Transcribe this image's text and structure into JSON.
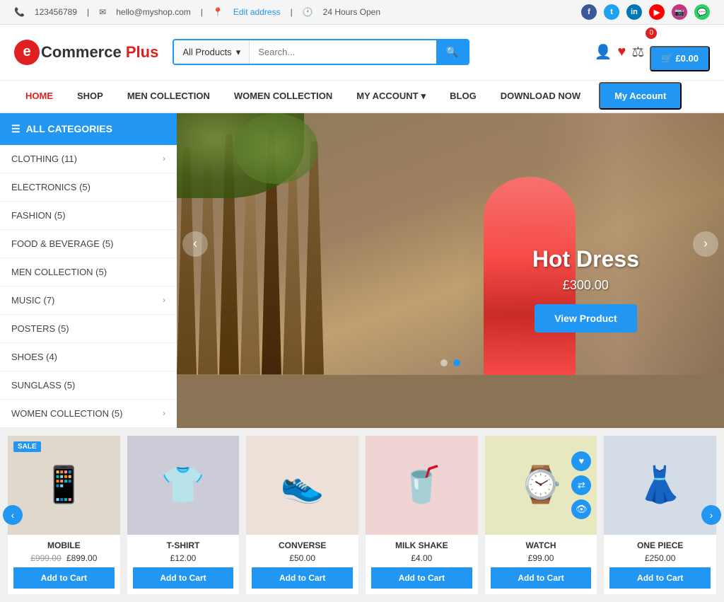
{
  "topbar": {
    "phone": "123456789",
    "email": "hello@myshop.com",
    "address": "Edit address",
    "hours": "24 Hours Open",
    "socials": [
      "fb",
      "tw",
      "li",
      "yt",
      "ig",
      "wa"
    ]
  },
  "header": {
    "logo_letter": "e",
    "logo_name": "Commerce ",
    "logo_plus": "Plus",
    "search_placeholder": "Search...",
    "search_dropdown": "All Products",
    "cart_amount": "£0.00",
    "cart_count": "0"
  },
  "nav": {
    "items": [
      {
        "label": "HOME",
        "active": true
      },
      {
        "label": "SHOP",
        "active": false
      },
      {
        "label": "MEN COLLECTION",
        "active": false
      },
      {
        "label": "WOMEN COLLECTION",
        "active": false
      },
      {
        "label": "MY ACCOUNT",
        "active": false,
        "has_dropdown": true
      },
      {
        "label": "BLOG",
        "active": false
      },
      {
        "label": "DOWNLOAD NOW",
        "active": false
      }
    ],
    "cta_label": "My Account"
  },
  "sidebar": {
    "header": "ALL CATEGORIES",
    "items": [
      {
        "label": "CLOTHING (11)",
        "has_arrow": true
      },
      {
        "label": "ELECTRONICS (5)",
        "has_arrow": false
      },
      {
        "label": "FASHION (5)",
        "has_arrow": false
      },
      {
        "label": "FOOD & BEVERAGE (5)",
        "has_arrow": false
      },
      {
        "label": "MEN COLLECTION (5)",
        "has_arrow": false
      },
      {
        "label": "MUSIC (7)",
        "has_arrow": true
      },
      {
        "label": "POSTERS (5)",
        "has_arrow": false
      },
      {
        "label": "SHOES (4)",
        "has_arrow": false
      },
      {
        "label": "SUNGLASS (5)",
        "has_arrow": false
      },
      {
        "label": "WOMEN COLLECTION (5)",
        "has_arrow": true
      }
    ]
  },
  "hero": {
    "title": "Hot Dress",
    "price": "£300.00",
    "btn_label": "View Product",
    "dots": [
      false,
      true
    ]
  },
  "products": {
    "prev_label": "‹",
    "next_label": "›",
    "items": [
      {
        "name": "MOBILE",
        "price_old": "£999.00",
        "price_new": "£899.00",
        "sale": true,
        "emoji": "📱",
        "bg": "#e8e0d8",
        "btn": "Add to Cart"
      },
      {
        "name": "T-SHIRT",
        "price_old": "",
        "price_new": "£12.00",
        "sale": false,
        "emoji": "👕",
        "bg": "#d8d8e0",
        "btn": "Add to Cart"
      },
      {
        "name": "CONVERSE",
        "price_old": "",
        "price_new": "£50.00",
        "sale": false,
        "emoji": "👟",
        "bg": "#f0e8e0",
        "btn": "Add to Cart"
      },
      {
        "name": "MILK SHAKE",
        "price_old": "",
        "price_new": "£4.00",
        "sale": false,
        "emoji": "🥤",
        "bg": "#f0d8d8",
        "btn": "Add to Cart"
      },
      {
        "name": "WATCH",
        "price_old": "",
        "price_new": "£99.00",
        "sale": false,
        "emoji": "⌚",
        "bg": "#e8e8c8",
        "btn": "Add to Cart",
        "has_icons": true
      },
      {
        "name": "ONE PIECE",
        "price_old": "",
        "price_new": "£250.00",
        "sale": false,
        "emoji": "👗",
        "bg": "#d8e0e8",
        "btn": "Add to Cart"
      }
    ]
  }
}
